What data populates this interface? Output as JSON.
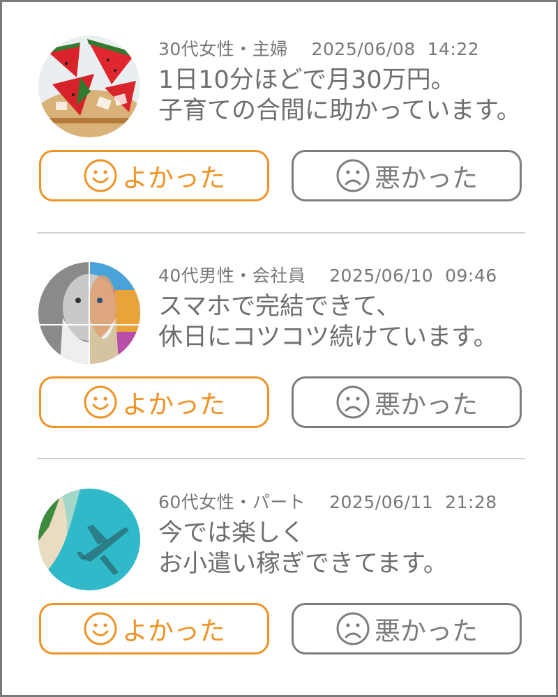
{
  "colors": {
    "good": "#ef9325",
    "bad": "#7d7d7d",
    "text": "#6e6e6e",
    "divider": "#cfcfcf"
  },
  "reviews": [
    {
      "avatar_icon": "watermelon-image",
      "profile": "30代女性・主婦",
      "datetime": "2025/06/08  14:22",
      "comment": "1日10分ほどで月30万円。\n子育ての合間に助かっています。",
      "good_label": "よかった",
      "bad_label": "悪かった"
    },
    {
      "avatar_icon": "bearded-man-portrait-image",
      "profile": "40代男性・会社員",
      "datetime": "2025/06/10  09:46",
      "comment": "スマホで完結できて、\n休日にコツコツ続けています。",
      "good_label": "よかった",
      "bad_label": "悪かった"
    },
    {
      "avatar_icon": "beach-airplane-shadow-image",
      "profile": "60代女性・パート",
      "datetime": "2025/06/11  21:28",
      "comment": "今では楽しく\nお小遣い稼ぎできてます。",
      "good_label": "よかった",
      "bad_label": "悪かった"
    }
  ]
}
